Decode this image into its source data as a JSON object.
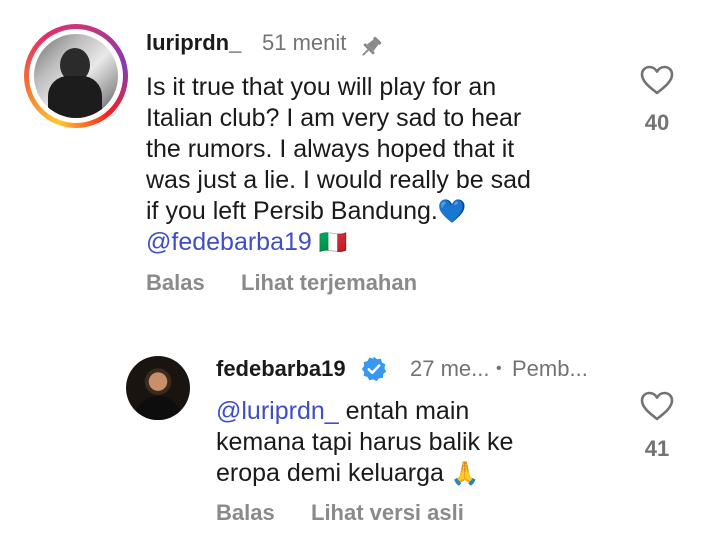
{
  "comment": {
    "username": "luriprdn_",
    "time": "51 menit",
    "text_lines": [
      "Is it true that you will play for an",
      "Italian club? I am very sad to hear",
      "the rumors. I always hoped that it",
      "was just a lie. I would really be sad",
      "if you left Persib Bandung."
    ],
    "heart_emoji": "💙",
    "mention": "@fedebarba19",
    "flag_emoji": "🇮🇹",
    "like_count": "40",
    "reply_label": "Balas",
    "translate_label": "Lihat terjemahan",
    "icons": {
      "pin": "pin-icon",
      "like": "heart-outline-icon"
    }
  },
  "reply": {
    "username": "fedebarba19",
    "time": "27 me...",
    "dot": "•",
    "author_tag": "Pemb...",
    "mention": "@luriprdn_",
    "text_first": " entah main",
    "text_lines": [
      "kemana tapi harus balik ke",
      "eropa demi keluarga"
    ],
    "pray_emoji": "🙏",
    "like_count": "41",
    "reply_label": "Balas",
    "original_label": "Lihat versi asli",
    "icons": {
      "verified": "verified-badge-icon",
      "like": "heart-outline-icon"
    },
    "accent": "#3897f0"
  }
}
